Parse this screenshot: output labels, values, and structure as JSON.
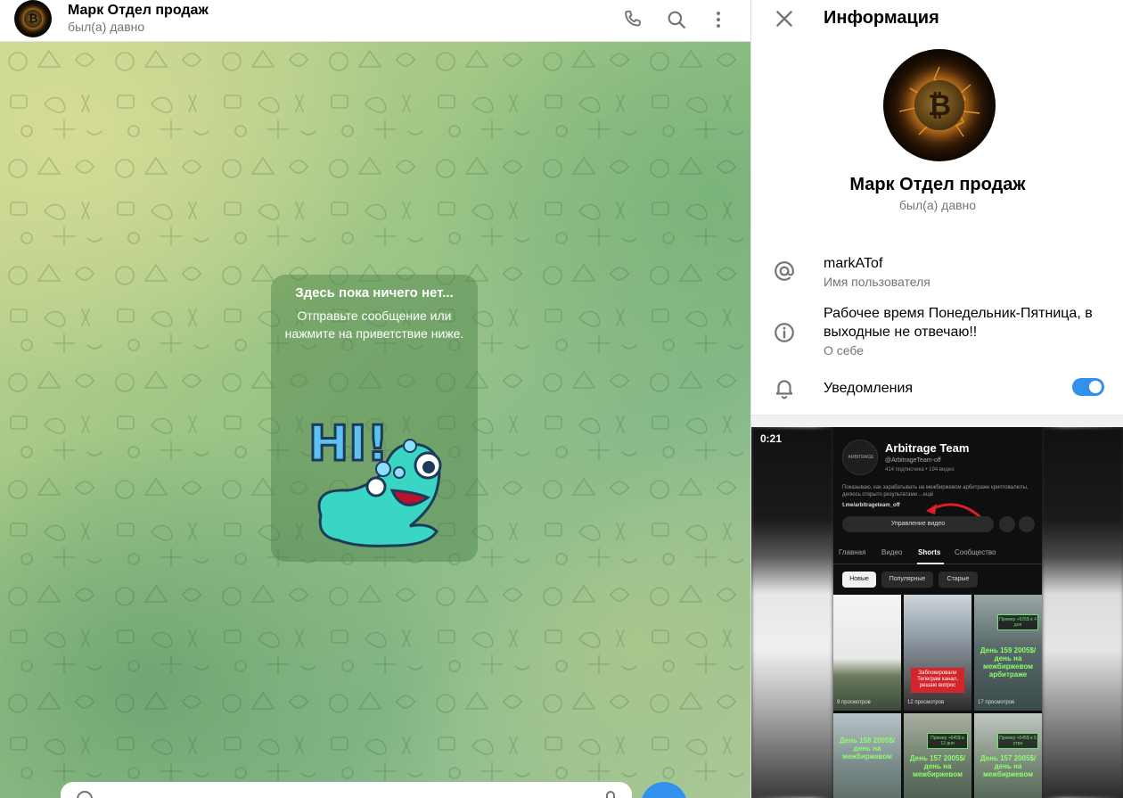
{
  "chat": {
    "title": "Марк Отдел продаж",
    "status": "был(а) давно",
    "empty": {
      "title": "Здесь пока ничего нет...",
      "text": "Отправьте сообщение или нажмите на приветствие ниже."
    },
    "sticker_text": "HI!"
  },
  "info": {
    "title": "Информация",
    "name": "Марк Отдел продаж",
    "status": "был(а) давно",
    "username": "markATof",
    "username_label": "Имя пользователя",
    "bio": "Рабочее время Понедельник-Пятница, в выходные не отвечаю!!",
    "bio_label": "О себе",
    "notifications_label": "Уведомления",
    "notifications_on": true,
    "accent_color": "#3390ec"
  },
  "media": {
    "duration": "0:21",
    "channel_logo_text": "ARBITRAGE",
    "channel_name": "Arbitrage Team",
    "channel_handle": "@ArbitrageTeam-off",
    "channel_stats": "414 подписчика • 194 видео",
    "channel_desc": "Показываю, как зарабатывать на межбиржевом арбитраже криптовалюты, делюсь открыто результатами ...ещё",
    "channel_link": "t.me/arbitrageteam_off",
    "manage_label": "Управление видео",
    "tabs": [
      "Главная",
      "Видео",
      "Shorts",
      "Сообщество"
    ],
    "chips": [
      "Новые",
      "Популярные",
      "Старые"
    ],
    "cells": [
      {
        "views": "9 просмотров"
      },
      {
        "label": "Заблокировали Телеграм канал, решаю вопрос",
        "views": "12 просмотров"
      },
      {
        "box": "Пример +925$ в 4 дня",
        "label": "День 159 2005$/день на межбиржевом арбитраже",
        "views": "17 просмотров"
      },
      {
        "label": "День 158 2005$/день на межбиржевом"
      },
      {
        "box": "Пример +645$ в 12 дня",
        "label": "День 157 2005$/день на межбиржевом"
      },
      {
        "box": "Пример +645$ в 5 утра",
        "label": "День 157 2005$/день на межбиржевом"
      }
    ]
  }
}
